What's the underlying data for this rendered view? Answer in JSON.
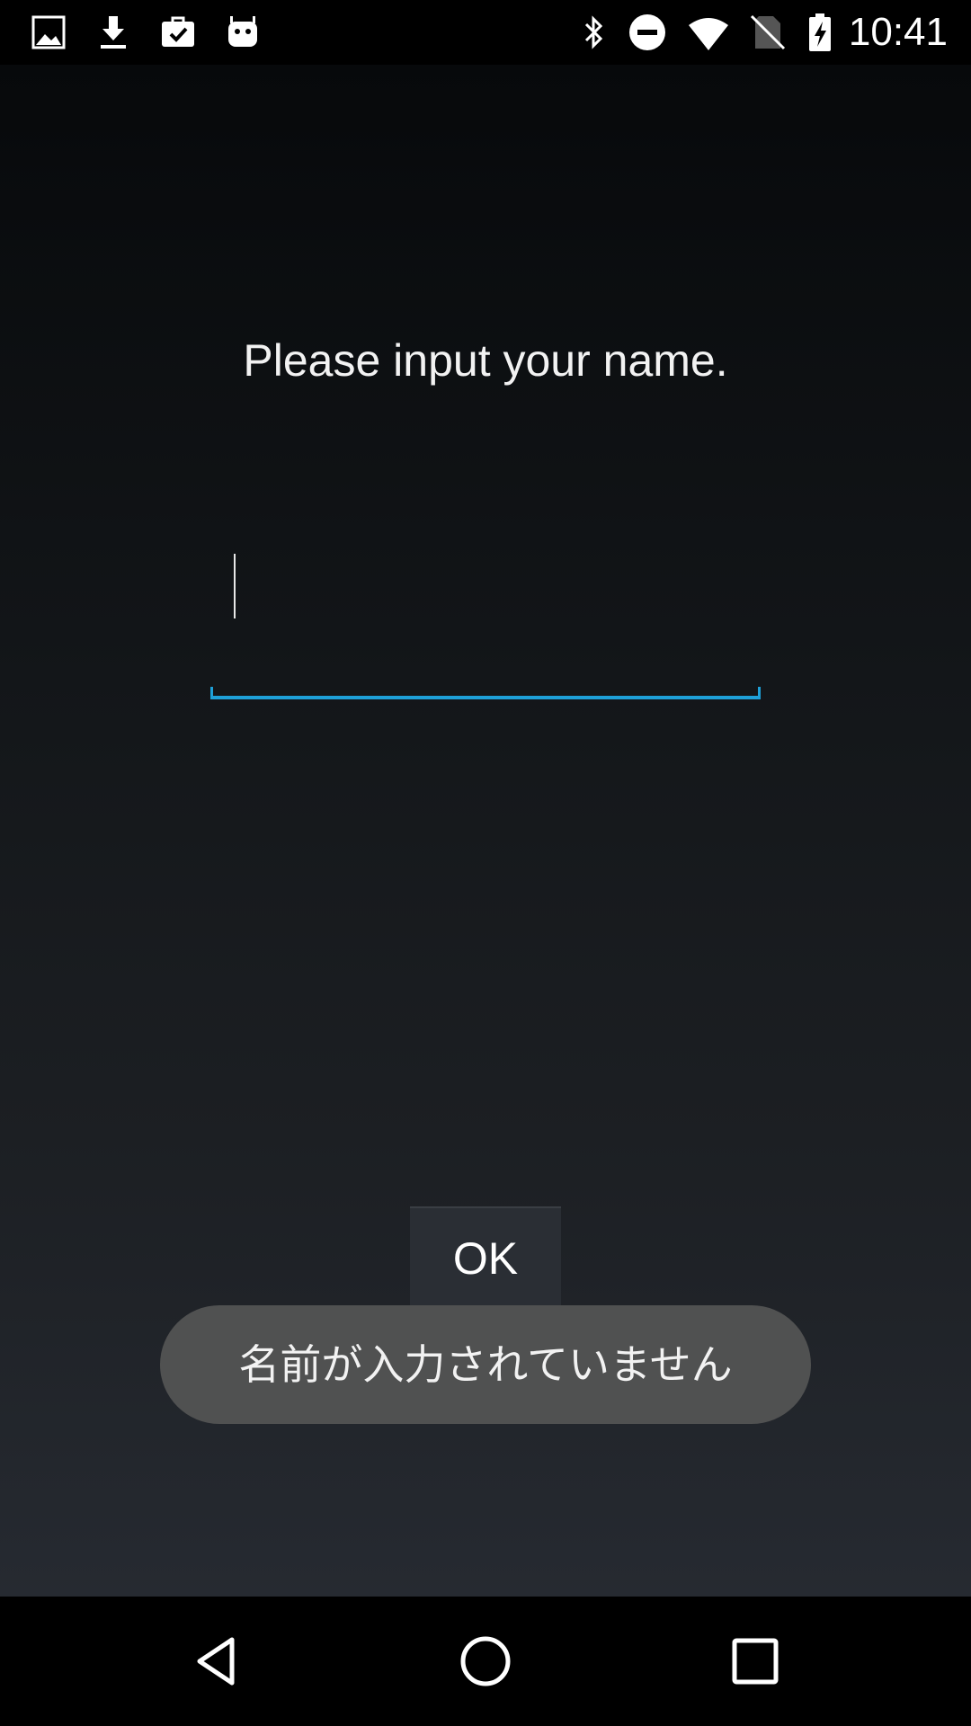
{
  "status_bar": {
    "clock": "10:41",
    "left_icons": [
      "image-icon",
      "download-icon",
      "work-check-icon",
      "android-icon"
    ],
    "right_icons": [
      "bluetooth-icon",
      "do-not-disturb-icon",
      "wifi-icon",
      "no-sim-icon",
      "battery-charging-icon"
    ]
  },
  "main": {
    "prompt": "Please input your name.",
    "name_input": {
      "value": "",
      "accent_color": "#1ea0d8"
    },
    "ok_label": "OK"
  },
  "toast": {
    "message": "名前が入力されていません"
  },
  "nav_bar": {
    "icons": [
      "back-icon",
      "home-icon",
      "recents-icon"
    ]
  }
}
